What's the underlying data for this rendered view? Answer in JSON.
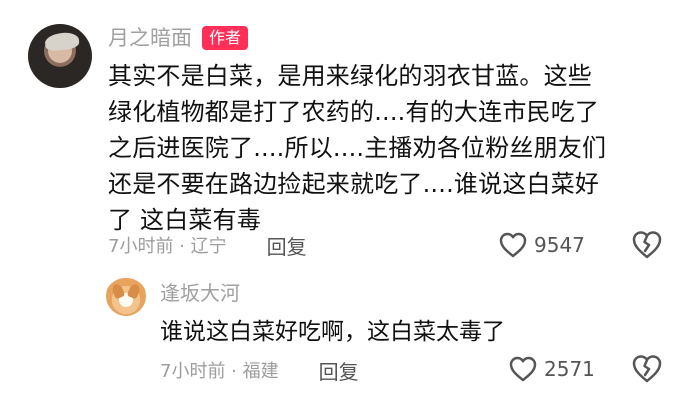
{
  "main_comment": {
    "author": "月之暗面",
    "badge": "作者",
    "lines": [
      "其实不是白菜，是用来绿化的羽衣甘蓝。这些",
      "绿化植物都是打了农药的....有的大连市民吃了",
      "之后进医院了....所以....主播劝各位粉丝朋友们",
      "还是不要在路边捡起来就吃了....谁说这白菜好",
      "了 这白菜有毒"
    ],
    "meta": "7小时前 · 辽宁",
    "reply_label": "回复",
    "likes": "9547",
    "icons": {
      "like": "heart-outline",
      "dislike": "broken-heart-outline"
    }
  },
  "reply_comment": {
    "author": "逢坂大河",
    "text": "谁说这白菜好吃啊，这白菜太毒了",
    "meta": "7小时前 · 福建",
    "reply_label": "回复",
    "likes": "2571",
    "icons": {
      "like": "heart-outline",
      "dislike": "broken-heart-outline"
    }
  },
  "colors": {
    "text": "#111111",
    "secondary": "#a0a0a0",
    "badge": "#ff2f58",
    "icon": "#555555"
  }
}
